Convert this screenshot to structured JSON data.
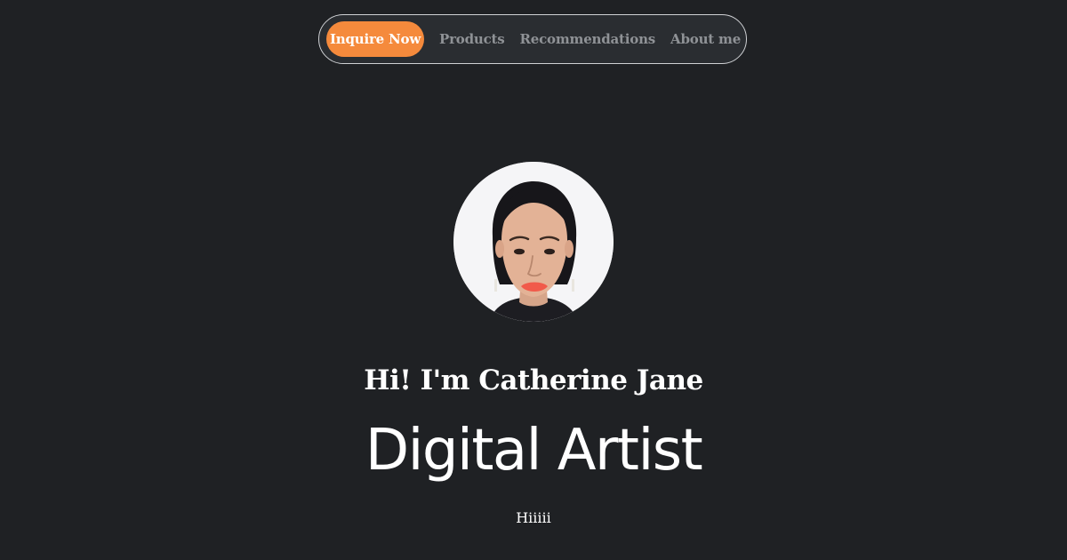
{
  "nav": {
    "cta_label": "Inquire Now",
    "links": [
      {
        "label": "Products"
      },
      {
        "label": "Recommendations"
      },
      {
        "label": "About me"
      }
    ]
  },
  "profile": {
    "greeting": "Hi! I'm Catherine Jane",
    "role": "Digital Artist",
    "tagline": "Hiiiii"
  },
  "colors": {
    "background": "#1f2124",
    "nav_background": "#2a2d31",
    "nav_border": "#cfd1d4",
    "cta": "#f58a3c",
    "nav_link": "#8f9296",
    "text": "#ffffff"
  }
}
